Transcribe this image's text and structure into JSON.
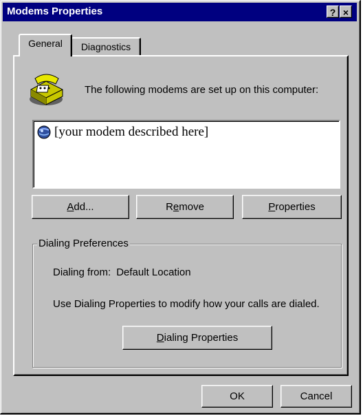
{
  "window": {
    "title": "Modems Properties",
    "help_button": "?",
    "close_button": "×"
  },
  "tabs": [
    {
      "label": "General",
      "active": true
    },
    {
      "label": "Diagnostics",
      "active": false
    }
  ],
  "general": {
    "header_text": "The following modems are set up on this computer:",
    "modems": [
      {
        "label": "[your modem described here]"
      }
    ],
    "buttons": {
      "add": {
        "mnemonic": "A",
        "rest": "dd..."
      },
      "remove": {
        "pre": "R",
        "mnemonic": "e",
        "rest": "move"
      },
      "properties": {
        "mnemonic": "P",
        "rest": "roperties"
      }
    },
    "dialing_preferences": {
      "group_label": "Dialing Preferences",
      "dialing_from_label": "Dialing from:",
      "dialing_from_value": "Default Location",
      "description": "Use Dialing Properties to modify how your calls are dialed.",
      "dialing_properties_button": {
        "mnemonic": "D",
        "rest": "ialing Properties"
      }
    }
  },
  "footer": {
    "ok_label": "OK",
    "cancel_label": "Cancel"
  },
  "icons": {
    "phone": "telephone-icon",
    "modem": "modem-icon"
  },
  "colors": {
    "titlebar": "#000080",
    "face": "#c0c0c0"
  }
}
